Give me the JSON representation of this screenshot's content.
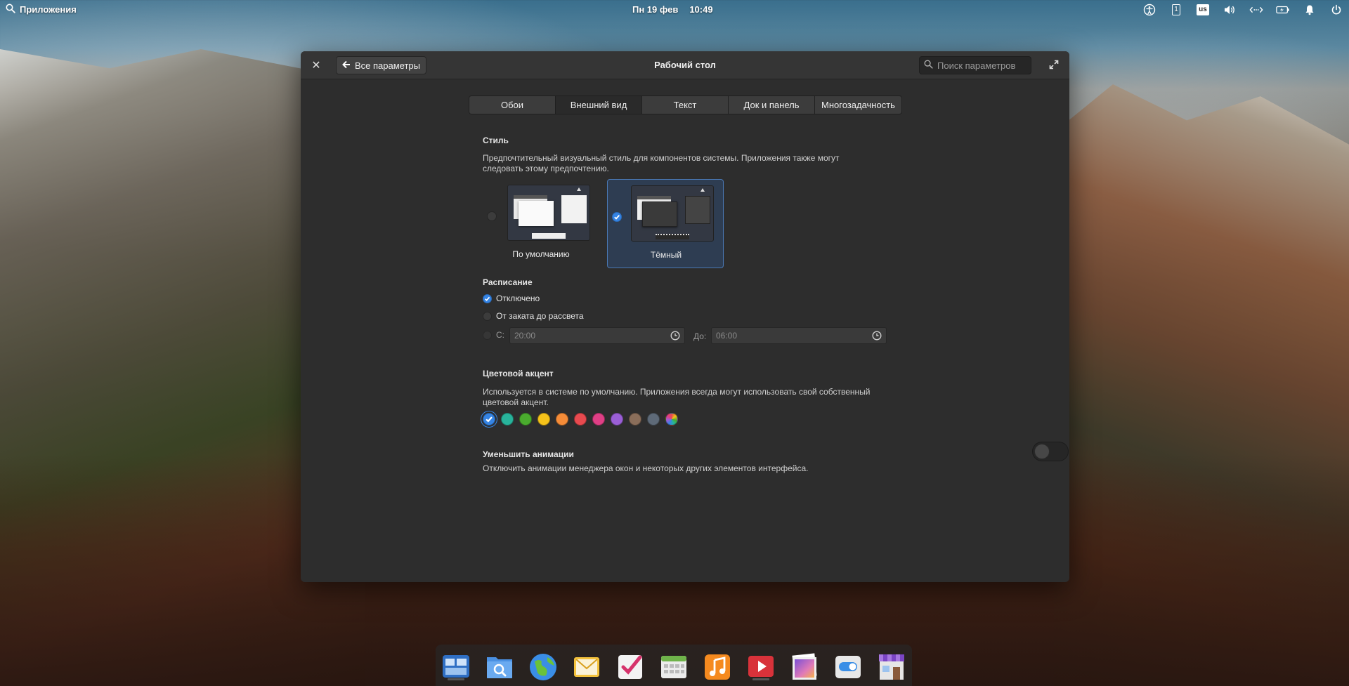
{
  "top_panel": {
    "apps_label": "Приложения",
    "date": "Пн 19 фев",
    "time": "10:49",
    "workspace_indicator": "1",
    "keyboard_layout": "us"
  },
  "window": {
    "title": "Рабочий стол",
    "back_label": "Все параметры",
    "search_placeholder": "Поиск параметров",
    "tabs": [
      {
        "label": "Обои"
      },
      {
        "label": "Внешний вид"
      },
      {
        "label": "Текст"
      },
      {
        "label": "Док и панель"
      },
      {
        "label": "Многозадачность"
      }
    ],
    "active_tab": "Внешний вид"
  },
  "style": {
    "title": "Стиль",
    "description": "Предпочтительный визуальный стиль для компонентов системы. Приложения также могут следовать этому предпочтению.",
    "options": [
      {
        "label": "По умолчанию",
        "selected": false
      },
      {
        "label": "Тёмный",
        "selected": true
      }
    ]
  },
  "schedule": {
    "title": "Расписание",
    "options": [
      {
        "label": "Отключено",
        "selected": true
      },
      {
        "label": "От заката до рассвета",
        "selected": false
      }
    ],
    "from_label": "С:",
    "from_value": "20:00",
    "to_label": "До:",
    "to_value": "06:00"
  },
  "accent": {
    "title": "Цветовой акцент",
    "description": "Используется в системе по умолчанию. Приложения всегда могут использовать свой собственный цветовой акцент.",
    "colors": [
      "#3584e4",
      "#28b39b",
      "#4aab2e",
      "#f5c21a",
      "#f58c38",
      "#e84a4f",
      "#df3f85",
      "#9a5fd6",
      "#8a6e5a",
      "#5e6a78",
      "multicolor"
    ],
    "selected_index": 0
  },
  "animations": {
    "title": "Уменьшить анимации",
    "description": "Отключить анимации менеджера окон и некоторых других элементов интерфейса.",
    "enabled": false
  },
  "dock": {
    "apps": [
      {
        "name": "multitasking-view-icon",
        "running": false
      },
      {
        "name": "files-icon",
        "running": false
      },
      {
        "name": "web-browser-icon",
        "running": false
      },
      {
        "name": "mail-icon",
        "running": false
      },
      {
        "name": "tasks-icon",
        "running": false
      },
      {
        "name": "calendar-icon",
        "running": false
      },
      {
        "name": "music-icon",
        "running": false
      },
      {
        "name": "videos-icon",
        "running": false
      },
      {
        "name": "photos-icon",
        "running": false
      },
      {
        "name": "system-settings-icon",
        "running": true
      },
      {
        "name": "appcenter-icon",
        "running": false
      }
    ]
  }
}
